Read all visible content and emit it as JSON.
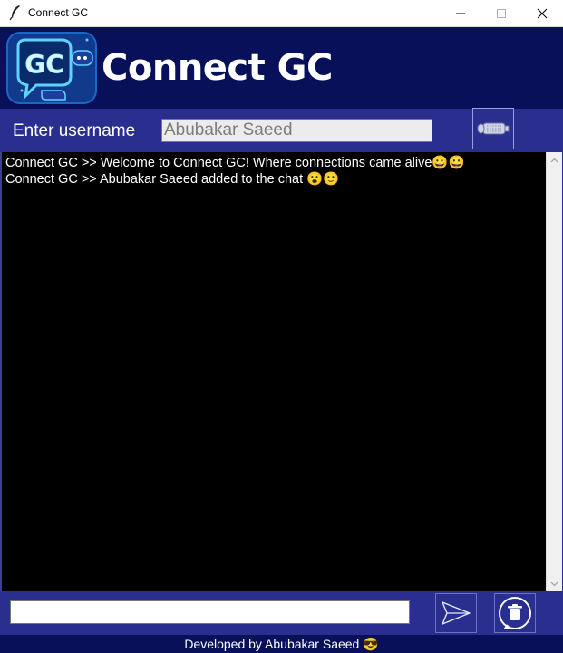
{
  "window": {
    "title": "Connect GC"
  },
  "header": {
    "logo_text": "GC",
    "brand": "Connect GC"
  },
  "userbar": {
    "label": "Enter username",
    "username_value": "Abubakar Saeed"
  },
  "chat": {
    "messages": [
      "Connect GC >> Welcome to Connect GC! Where connections came alive😀😀",
      "Connect GC >> Abubakar Saeed added to the chat 😮🙂"
    ]
  },
  "composer": {
    "message_value": ""
  },
  "footer": {
    "text": "Developed by Abubakar Saeed 😎"
  },
  "icons": {
    "app": "feather-icon",
    "connect": "connect-plug-icon",
    "send": "send-arrow-icon",
    "clear": "trash-icon"
  },
  "colors": {
    "header_bg": "#08105a",
    "bar_bg": "#2a2e8e",
    "chat_bg": "#000000"
  }
}
